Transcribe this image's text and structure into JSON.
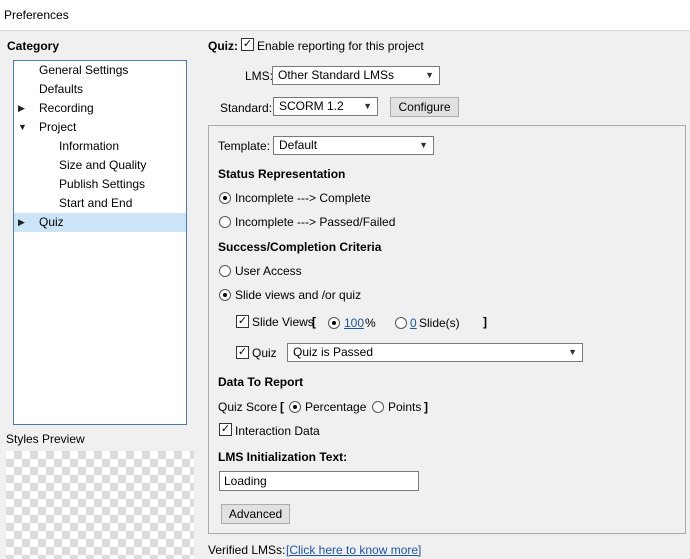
{
  "window": {
    "title": "Preferences"
  },
  "sidebar": {
    "category_label": "Category",
    "items": [
      {
        "label": "General Settings",
        "arrow": ""
      },
      {
        "label": "Defaults",
        "arrow": ""
      },
      {
        "label": "Recording",
        "arrow": "▶"
      },
      {
        "label": "Project",
        "arrow": "▼"
      },
      {
        "label": "Information",
        "arrow": ""
      },
      {
        "label": "Size and Quality",
        "arrow": ""
      },
      {
        "label": "Publish Settings",
        "arrow": ""
      },
      {
        "label": "Start and End",
        "arrow": ""
      },
      {
        "label": "Quiz",
        "arrow": "▶",
        "selected": true
      }
    ],
    "styles_preview_label": "Styles Preview"
  },
  "quiz": {
    "label": "Quiz:",
    "enable_reporting": {
      "label": "Enable reporting for this project",
      "checked": true
    },
    "lms": {
      "label": "LMS:",
      "value": "Other Standard LMSs"
    },
    "standard": {
      "label": "Standard:",
      "value": "SCORM 1.2"
    },
    "configure_label": "Configure"
  },
  "panel": {
    "template": {
      "label": "Template:",
      "value": "Default"
    },
    "status_representation": {
      "heading": "Status Representation",
      "options": [
        {
          "label": "Incomplete ---> Complete",
          "selected": true
        },
        {
          "label": "Incomplete ---> Passed/Failed",
          "selected": false
        }
      ]
    },
    "success_criteria": {
      "heading": "Success/Completion Criteria",
      "user_access": {
        "label": "User Access",
        "selected": false
      },
      "slide_views_or_quiz": {
        "label": "Slide views and /or quiz",
        "selected": true
      },
      "slide_views": {
        "label": "Slide Views",
        "checked": true,
        "bracket_open": "[",
        "bracket_close": "]",
        "percent_value": "100",
        "percent_unit": "%",
        "percent_selected": true,
        "slides_value": "0",
        "slides_unit": "Slide(s)",
        "slides_selected": false
      },
      "quiz": {
        "label": "Quiz",
        "checked": true,
        "value": "Quiz is Passed"
      }
    },
    "data_to_report": {
      "heading": "Data To Report",
      "quiz_score_label": "Quiz Score",
      "bracket_open": "[",
      "bracket_close": "]",
      "percentage": {
        "label": "Percentage",
        "selected": true
      },
      "points": {
        "label": "Points",
        "selected": false
      },
      "interaction_data": {
        "label": "Interaction Data",
        "checked": true
      }
    },
    "lms_init": {
      "heading": "LMS Initialization Text:",
      "value": "Loading"
    },
    "advanced_label": "Advanced"
  },
  "footer": {
    "verified_label": "Verified LMSs:",
    "link_text": "[Click here to know more]"
  },
  "icons": {
    "check": "✓",
    "caret": "▼"
  }
}
